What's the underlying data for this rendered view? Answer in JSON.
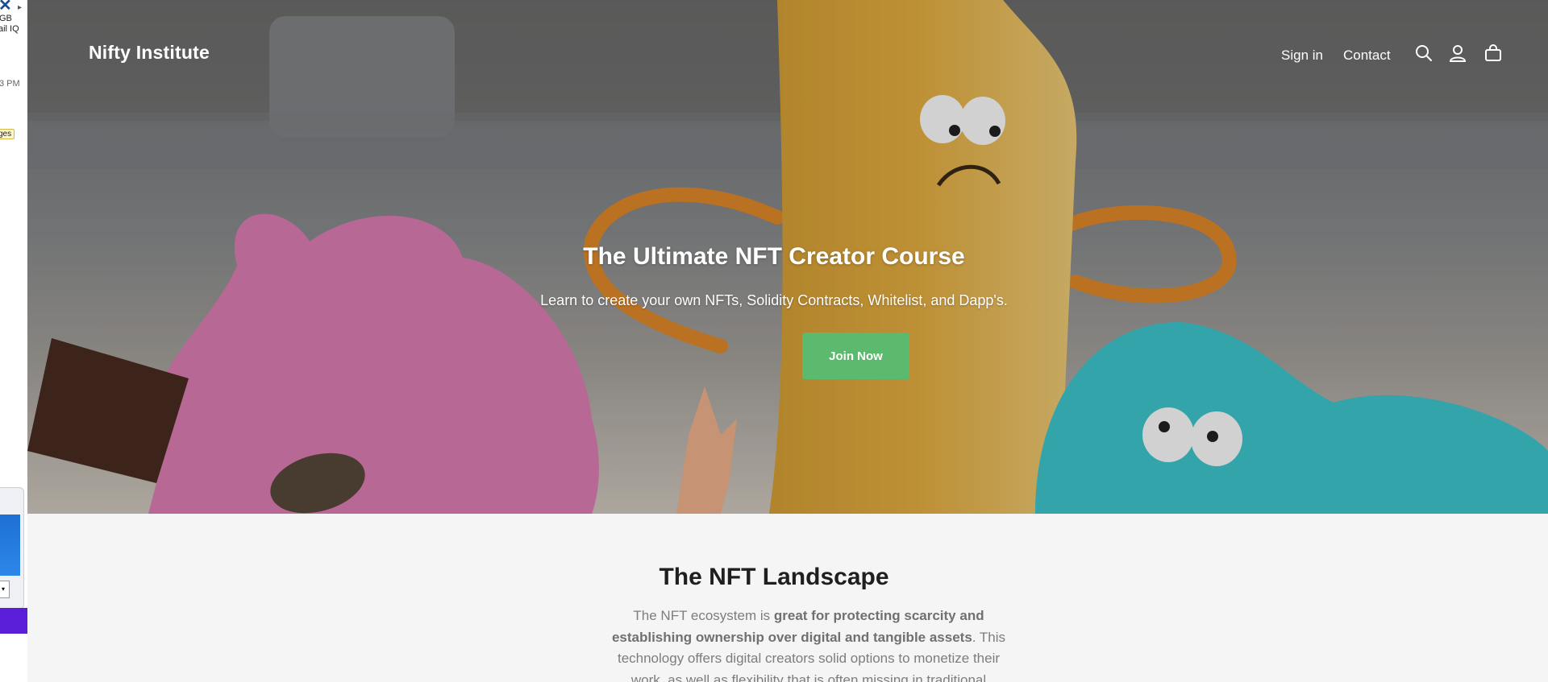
{
  "background_window": {
    "lines": [
      "GB",
      "ail IQ",
      "3 PM",
      "ges"
    ]
  },
  "header": {
    "logo": "Nifty Institute",
    "nav": {
      "signin": "Sign in",
      "contact": "Contact"
    },
    "icons": [
      "search-icon",
      "account-icon",
      "cart-icon"
    ]
  },
  "hero": {
    "title": "The Ultimate NFT Creator Course",
    "subtitle": "Learn to create your own NFTs, Solidity Contracts, Whitelist, and Dapp's.",
    "button": "Join Now"
  },
  "landscape": {
    "heading": "The NFT Landscape",
    "para_1": "The NFT ecosystem is ",
    "para_bold": "great for protecting scarcity and establishing ownership over digital and tangible assets",
    "para_2": ". This technology offers digital creators solid options to monetize their work, as well as flexibility that is often missing in traditional"
  },
  "colors": {
    "button_bg": "#5cba6e",
    "section_bg": "#f5f5f5",
    "heading": "#1f1f1f",
    "body_text": "#7d7d7d"
  }
}
